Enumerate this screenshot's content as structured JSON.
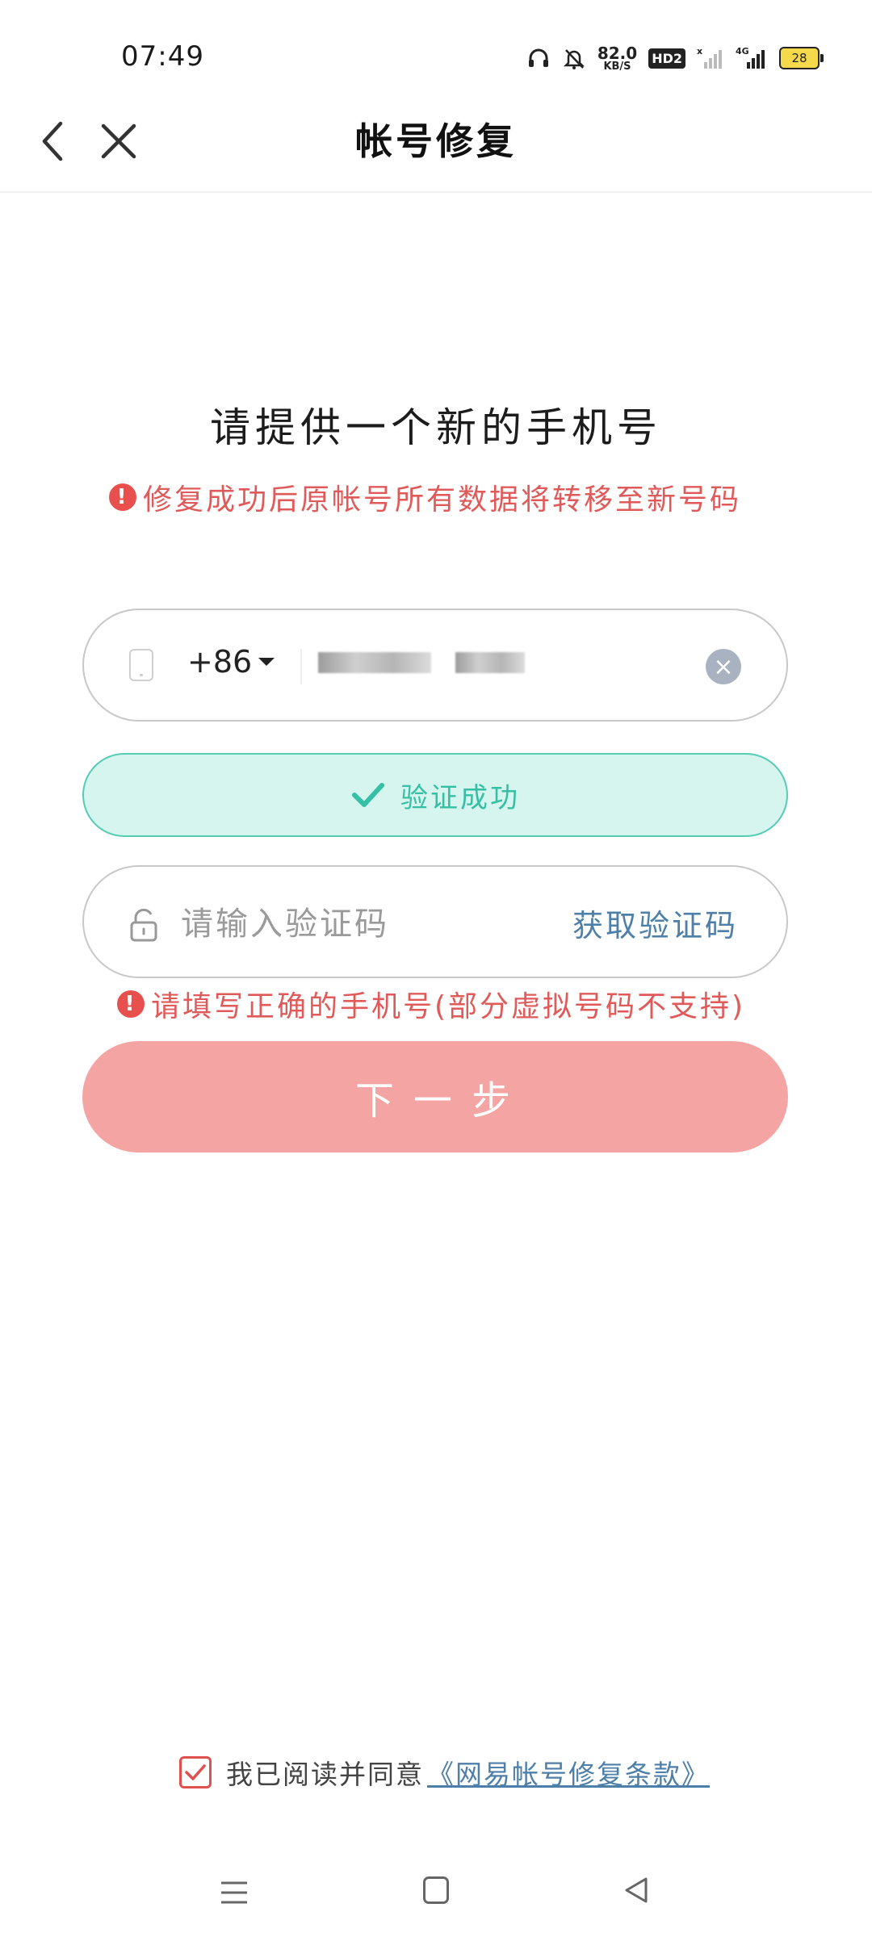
{
  "status_bar": {
    "time": "07:49",
    "net_speed_value": "82.0",
    "net_speed_unit": "KB/S",
    "hd_badge": "HD2",
    "battery_level": "28",
    "icons": [
      "headphones-icon",
      "bell-muted-icon",
      "signal-icon",
      "signal-4g-icon",
      "battery-icon"
    ]
  },
  "header": {
    "title": "帐号修复"
  },
  "main": {
    "heading": "请提供一个新的手机号",
    "warning_top": "修复成功后原帐号所有数据将转移至新号码",
    "phone_field": {
      "country_code": "+86"
    },
    "verify_status": "验证成功",
    "code_field": {
      "placeholder": "请输入验证码",
      "get_code_label": "获取验证码"
    },
    "warning_bottom": "请填写正确的手机号(部分虚拟号码不支持)",
    "next_button": "下一步"
  },
  "agreement": {
    "checked": true,
    "text": "我已阅读并同意",
    "link": "《网易帐号修复条款》"
  },
  "colors": {
    "accent_red": "#e8504d",
    "next_button": "#f5a4a4",
    "success_green": "#35c0a5",
    "link_blue": "#4d7fa8"
  }
}
